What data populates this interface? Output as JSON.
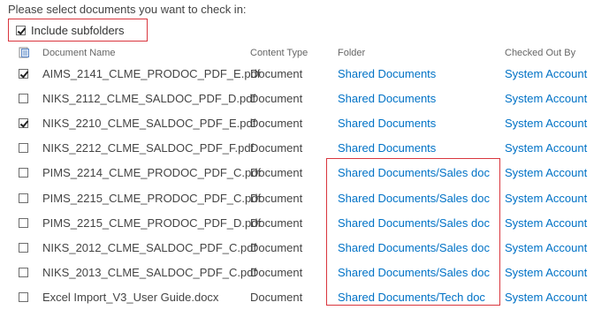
{
  "instruction": "Please select documents you want to check in:",
  "include_subfolders": {
    "label": "Include subfolders",
    "checked": true
  },
  "columns": {
    "name": "Document Name",
    "type": "Content Type",
    "folder": "Folder",
    "owner": "Checked Out By"
  },
  "rows": [
    {
      "checked": true,
      "name": "AIMS_2141_CLME_PRODOC_PDF_E.pdf",
      "type": "Document",
      "folder": "Shared Documents",
      "owner": "System Account"
    },
    {
      "checked": false,
      "name": "NIKS_2112_CLME_SALDOC_PDF_D.pdf",
      "type": "Document",
      "folder": "Shared Documents",
      "owner": "System Account"
    },
    {
      "checked": true,
      "name": "NIKS_2210_CLME_SALDOC_PDF_E.pdf",
      "type": "Document",
      "folder": "Shared Documents",
      "owner": "System Account"
    },
    {
      "checked": false,
      "name": "NIKS_2212_CLME_SALDOC_PDF_F.pdf",
      "type": "Document",
      "folder": "Shared Documents",
      "owner": "System Account"
    },
    {
      "checked": false,
      "name": "PIMS_2214_CLME_PRODOC_PDF_C.pdf",
      "type": "Document",
      "folder": "Shared Documents/Sales doc",
      "owner": "System Account"
    },
    {
      "checked": false,
      "name": "PIMS_2215_CLME_PRODOC_PDF_C.pdf",
      "type": "Document",
      "folder": "Shared Documents/Sales doc",
      "owner": "System Account"
    },
    {
      "checked": false,
      "name": "PIMS_2215_CLME_PRODOC_PDF_D.pdf",
      "type": "Document",
      "folder": "Shared Documents/Sales doc",
      "owner": "System Account"
    },
    {
      "checked": false,
      "name": "NIKS_2012_CLME_SALDOC_PDF_C.pdf",
      "type": "Document",
      "folder": "Shared Documents/Sales doc",
      "owner": "System Account"
    },
    {
      "checked": false,
      "name": "NIKS_2013_CLME_SALDOC_PDF_C.pdf",
      "type": "Document",
      "folder": "Shared Documents/Sales doc",
      "owner": "System Account"
    },
    {
      "checked": false,
      "name": "Excel Import_V3_User Guide.docx",
      "type": "Document",
      "folder": "Shared Documents/Tech doc",
      "owner": "System Account"
    }
  ],
  "colors": {
    "link": "#0072c6",
    "highlight_border": "#d9363e"
  }
}
